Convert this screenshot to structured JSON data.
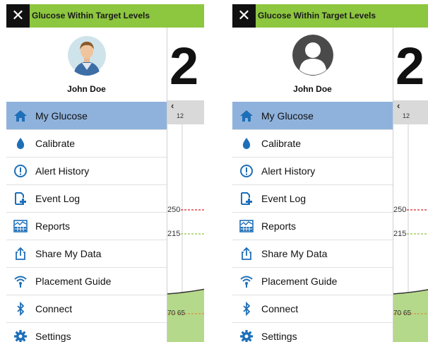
{
  "panels": [
    {
      "header": {
        "close_icon": "close-icon",
        "title": "Glucose Within Target Levels"
      },
      "profile": {
        "name": "John Doe",
        "avatar": "person-photo-avatar"
      },
      "menu": [
        {
          "label": "My Glucose",
          "icon": "home-icon",
          "active": true
        },
        {
          "label": "Calibrate",
          "icon": "blood-drop-icon"
        },
        {
          "label": "Alert History",
          "icon": "alert-circle-icon"
        },
        {
          "label": "Event Log",
          "icon": "add-document-icon"
        },
        {
          "label": "Reports",
          "icon": "report-chart-icon"
        },
        {
          "label": "Share My Data",
          "icon": "share-icon"
        },
        {
          "label": "Placement Guide",
          "icon": "signal-icon"
        },
        {
          "label": "Connect",
          "icon": "bluetooth-icon"
        },
        {
          "label": "Settings",
          "icon": "gear-icon"
        }
      ],
      "glucose_screen": {
        "value": "2",
        "time_label": "12",
        "high_alert": "250",
        "high_target": "215",
        "low_values": "70 65"
      }
    },
    {
      "header": {
        "close_icon": "close-icon",
        "title": "Glucose Within Target Levels"
      },
      "profile": {
        "name": "John Doe",
        "avatar": "default-user-avatar"
      },
      "menu": [
        {
          "label": "My Glucose",
          "icon": "home-icon",
          "active": true
        },
        {
          "label": "Calibrate",
          "icon": "blood-drop-icon"
        },
        {
          "label": "Alert History",
          "icon": "alert-circle-icon"
        },
        {
          "label": "Event Log",
          "icon": "add-document-icon"
        },
        {
          "label": "Reports",
          "icon": "report-chart-icon"
        },
        {
          "label": "Share My Data",
          "icon": "share-icon"
        },
        {
          "label": "Placement Guide",
          "icon": "signal-icon"
        },
        {
          "label": "Connect",
          "icon": "bluetooth-icon"
        },
        {
          "label": "Settings",
          "icon": "gear-icon"
        }
      ],
      "glucose_screen": {
        "value": "2",
        "time_label": "12",
        "high_alert": "250",
        "high_target": "215",
        "low_values": "70 65"
      }
    }
  ],
  "colors": {
    "header_green": "#8dc63f",
    "active_item": "#8fb2dc",
    "icon_blue": "#1e6fb8",
    "alert_line_red": "#e02020",
    "target_line_green": "#8dc63f",
    "target_zone": "#b5d98a"
  }
}
